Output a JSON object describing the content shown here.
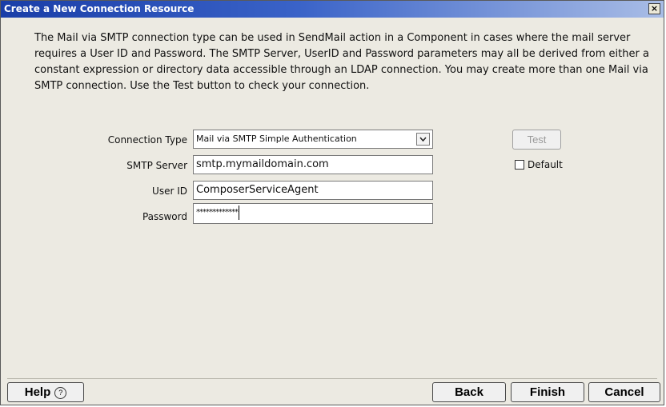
{
  "window": {
    "title": "Create a New Connection Resource",
    "close_label": "×"
  },
  "description": "The Mail via SMTP connection type can be used in SendMail action in a Component in cases where the mail server requires a User ID and Password. The SMTP Server, UserID and Password parameters may all be derived from either a constant expression or directory data accessible through an LDAP connection. You may create more than one Mail via SMTP connection. Use the Test button to check your connection.",
  "form": {
    "connection_type_label": "Connection Type",
    "connection_type_value": "Mail via SMTP Simple Authentication",
    "smtp_server_label": "SMTP Server",
    "smtp_server_value": "smtp.mymaildomain.com",
    "user_id_label": "User ID",
    "user_id_value": "ComposerServiceAgent",
    "password_label": "Password",
    "password_value": "*************"
  },
  "side": {
    "test_label": "Test",
    "default_label": "Default",
    "default_checked": false
  },
  "footer": {
    "help_label": "Help",
    "help_icon": "?",
    "back_label": "Back",
    "finish_label": "Finish",
    "cancel_label": "Cancel"
  }
}
